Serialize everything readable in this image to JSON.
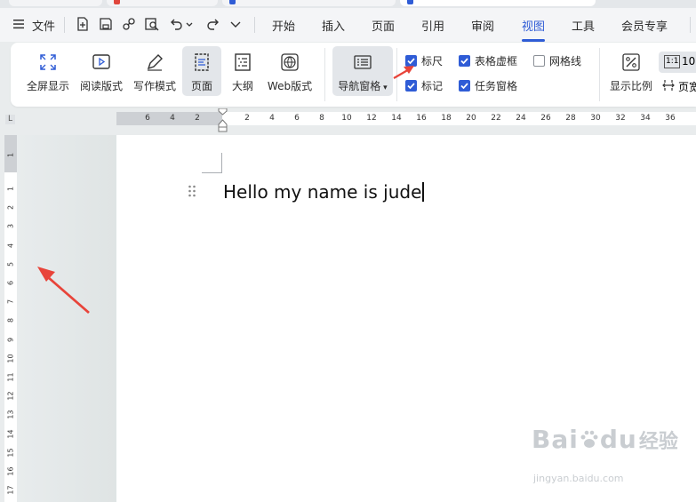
{
  "menubar": {
    "file_label": "文件",
    "tabs": [
      "开始",
      "插入",
      "页面",
      "引用",
      "审阅",
      "视图",
      "工具",
      "会员专享"
    ],
    "active_tab": "视图"
  },
  "ribbon": {
    "buttons": {
      "fullscreen": "全屏显示",
      "reading": "阅读版式",
      "writing": "写作模式",
      "page": "页面",
      "outline": "大纲",
      "web": "Web版式",
      "nav_pane": "导航窗格",
      "zoom": "显示比例",
      "hundred": "10",
      "page_width": "页宽"
    },
    "checkboxes": {
      "ruler": {
        "label": "标尺",
        "checked": true
      },
      "table_gridlines": {
        "label": "表格虚框",
        "checked": true
      },
      "gridlines": {
        "label": "网格线",
        "checked": false
      },
      "marks": {
        "label": "标记",
        "checked": true
      },
      "task_pane": {
        "label": "任务窗格",
        "checked": true
      }
    }
  },
  "ruler": {
    "corner": "L",
    "h_left_numbers": [
      "6",
      "4",
      "2"
    ],
    "h_numbers": [
      "2",
      "4",
      "6",
      "8",
      "10",
      "12",
      "14",
      "16",
      "18",
      "20",
      "22",
      "24",
      "26",
      "28",
      "30",
      "32",
      "34",
      "36"
    ],
    "v_top_number": "1",
    "v_numbers": [
      "1",
      "2",
      "3",
      "4",
      "5",
      "6",
      "7",
      "8",
      "9",
      "10",
      "11",
      "12",
      "13",
      "14",
      "15",
      "16",
      "17"
    ]
  },
  "document": {
    "text": "Hello my name is jude"
  },
  "watermark": {
    "brand": "Bai",
    "brand2": "du",
    "cn": "经验",
    "url": "jingyan.baidu.com"
  },
  "colors": {
    "accent": "#2f5cd6",
    "annotation_arrow": "#e8443a"
  }
}
